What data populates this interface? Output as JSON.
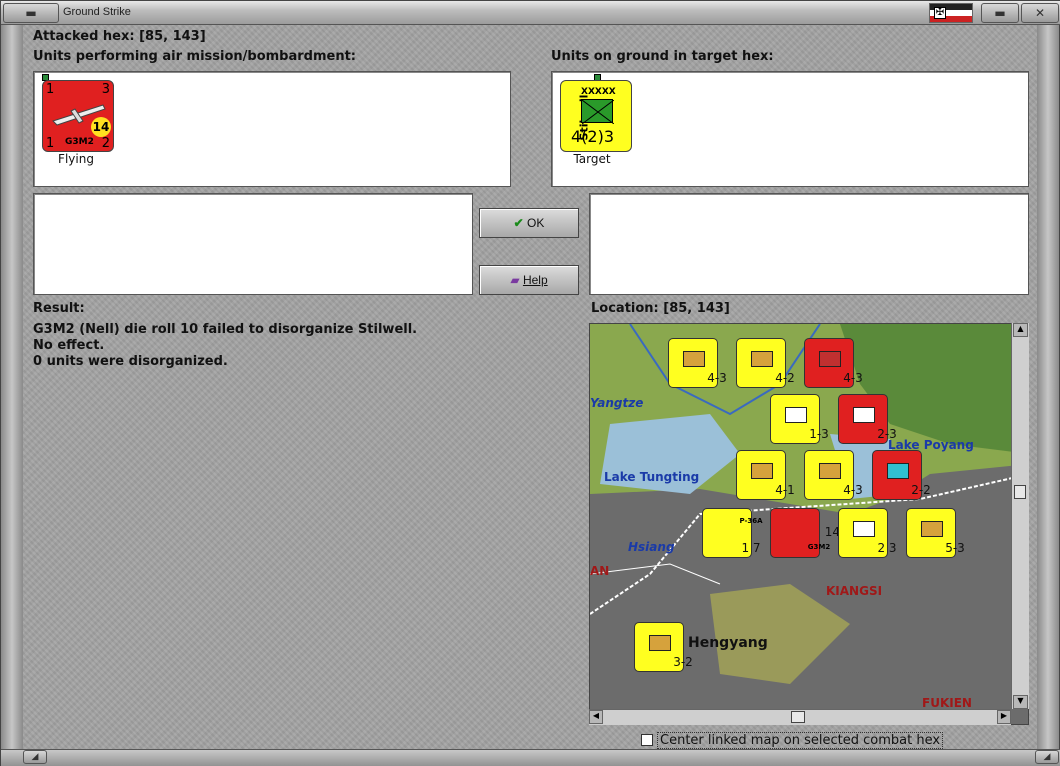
{
  "window": {
    "title": "Ground Strike"
  },
  "attacked_hex": "Attacked hex:  [85, 143]",
  "air_units_heading": "Units performing air mission/bombardment:",
  "ground_units_heading": "Units on ground in target hex:",
  "air_unit": {
    "name": "G3M2",
    "top_left": "1",
    "top_right": "3",
    "bottom_left": "1",
    "bottom_right": "2",
    "range": "14",
    "status": "Flying",
    "color": "#e02020"
  },
  "ground_unit": {
    "name": "Stilwell",
    "size": "XXXXX",
    "strength": "4(2)3",
    "status": "Target",
    "color": "#ffff20"
  },
  "buttons": {
    "ok": "OK",
    "help": "Help"
  },
  "result_heading": "Result:",
  "result_lines": [
    "G3M2 (Nell) die roll 10 failed to disorganize Stilwell.",
    "No effect.",
    "0 units were disorganized."
  ],
  "location": "Location:  [85, 143]",
  "map": {
    "labels": {
      "yangtze": "Yangtze",
      "lake_poyang": "Lake Poyang",
      "lake_tungting": "Lake Tungting",
      "hsiang": "Hsiang",
      "kiangsi": "KIANGSI",
      "hengyang": "Hengyang",
      "fukien": "FUKIEN",
      "an": "AN"
    },
    "counters": [
      {
        "str": "4-3",
        "color": "#ffff20"
      },
      {
        "str": "4-2",
        "color": "#ffff20"
      },
      {
        "str": "4-3",
        "color": "#e02020"
      },
      {
        "str": "1-3",
        "color": "#ffff20"
      },
      {
        "str": "2-3",
        "color": "#e02020"
      },
      {
        "str": "4-1",
        "color": "#ffff20"
      },
      {
        "str": "4-3",
        "color": "#ffff20"
      },
      {
        "str": "2-2",
        "color": "#e02020"
      },
      {
        "str": "1 7",
        "color": "#ffff20",
        "name": "P-36A"
      },
      {
        "str": "14",
        "color": "#e02020",
        "name": "G3M2"
      },
      {
        "str": "2 3",
        "color": "#ffff20"
      },
      {
        "str": "5-3",
        "color": "#ffff20"
      },
      {
        "str": "3-2",
        "color": "#ffff20"
      }
    ]
  },
  "center_linked": {
    "label": "Center linked map on selected combat hex",
    "checked": false
  }
}
